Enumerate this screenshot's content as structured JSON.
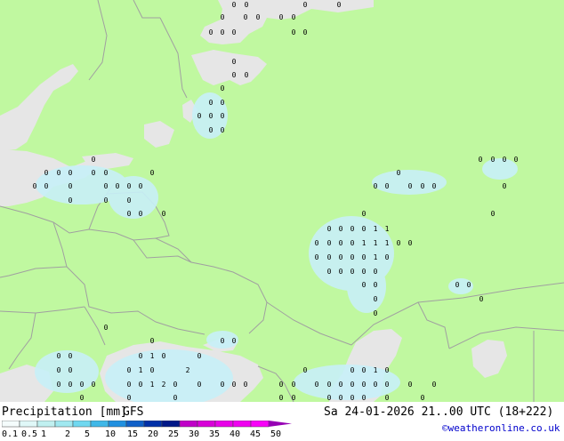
{
  "header": {
    "title": "Precipitation [mm]",
    "model": "GFS",
    "valid_time": "Sa 24-01-2026 21..00 UTC (18+222)"
  },
  "legend": {
    "colors": [
      "#f5fcfc",
      "#e0f8f8",
      "#c0f0f0",
      "#a0e8f0",
      "#70d8f0",
      "#40b8e8",
      "#2090e0",
      "#1060c8",
      "#0030a8",
      "#001888",
      "#c000c8",
      "#d800d8",
      "#e800e8",
      "#f000f0",
      "#f800f8",
      "#9600b4"
    ],
    "labels": [
      "0.1",
      "0.5",
      "1",
      "2",
      "5",
      "10",
      "15",
      "20",
      "25",
      "30",
      "35",
      "40",
      "45",
      "50"
    ]
  },
  "credit": "©weatheronline.co.uk",
  "map": {
    "land_color": "#c0f8a0",
    "sea_color": "#e6e6e6",
    "border_color": "#a0a0a0",
    "precip_color": "#c8f0f8",
    "precip_value_label": "0",
    "precip_value_label_alt": "1",
    "precip_value_label_alt2": "2"
  }
}
